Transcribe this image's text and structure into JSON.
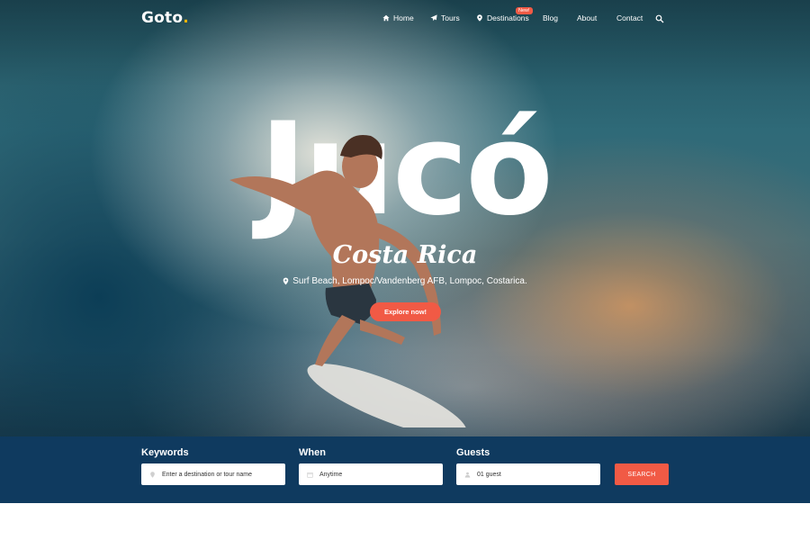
{
  "brand": {
    "name": "Goto",
    "dot": "."
  },
  "nav": {
    "items": [
      {
        "label": "Home",
        "icon": "home-icon"
      },
      {
        "label": "Tours",
        "icon": "paper-plane-icon"
      },
      {
        "label": "Destinations",
        "icon": "map-pin-icon"
      },
      {
        "label": "Blog"
      },
      {
        "label": "About"
      },
      {
        "label": "Contact"
      }
    ],
    "badge": "New!"
  },
  "hero": {
    "title": "Jucó",
    "subtitle": "Costa Rica",
    "location": "Surf Beach, Lompoc/Vandenberg AFB, Lompoc, Costarica.",
    "cta": "Explore now!"
  },
  "search": {
    "keywords": {
      "label": "Keywords",
      "placeholder": "Enter a destination or tour name"
    },
    "when": {
      "label": "When",
      "value": "Anytime"
    },
    "guests": {
      "label": "Guests",
      "value": "01 guest"
    },
    "submit": "SEARCH"
  },
  "colors": {
    "accent": "#f15a45",
    "brand_dot": "#f5b301",
    "search_bg": "#0f3a5f"
  }
}
